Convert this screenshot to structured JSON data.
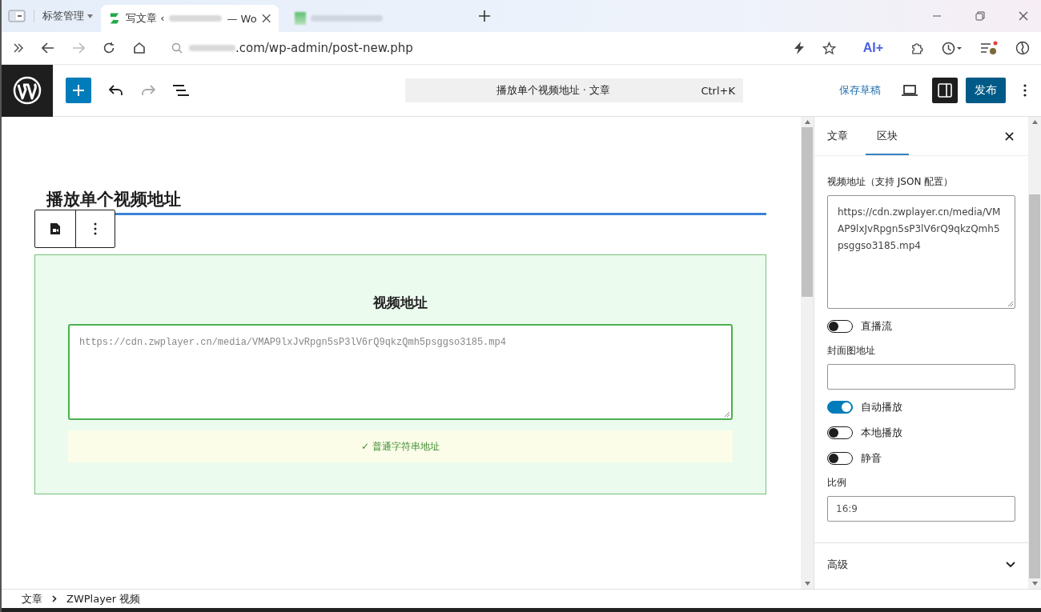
{
  "browser": {
    "tab_group": "标签管理",
    "tabs": [
      {
        "title_start": "写文章 ‹",
        "title_end": "— Wo",
        "selected": true
      },
      {
        "selected": false
      }
    ],
    "url": ".com/wp-admin/post-new.php",
    "ai_label": "AI+"
  },
  "editor_header": {
    "command_bar": {
      "title": "播放单个视频地址 · 文章",
      "shortcut": "Ctrl+K"
    },
    "save_draft": "保存草稿",
    "publish": "发布"
  },
  "post_title": "播放单个视频地址",
  "video_block": {
    "title": "视频地址",
    "url": "https://cdn.zwplayer.cn/media/VMAP9lxJvRpgn5sP3lV6rQ9qkzQmh5psggso3185.mp4",
    "status": "✓ 普通字符串地址"
  },
  "sidebar": {
    "tabs": [
      {
        "label": "文章",
        "selected": false
      },
      {
        "label": "区块",
        "selected": true
      }
    ],
    "fields": [
      {
        "kind": "textarea",
        "label": "视频地址（支持 JSON 配置）",
        "value": "https://cdn.zwplayer.cn/media/VMAP9lxJvRpgn5sP3lV6rQ9qkzQmh5psggso3185.mp4"
      },
      {
        "kind": "toggle",
        "label": "直播流",
        "on": false
      },
      {
        "kind": "text",
        "label": "封面图地址"
      },
      {
        "kind": "toggle",
        "label": "自动播放",
        "on": true
      },
      {
        "kind": "toggle",
        "label": "本地播放",
        "on": false
      },
      {
        "kind": "toggle",
        "label": "静音",
        "on": false
      },
      {
        "kind": "select",
        "label": "比例",
        "value": "16:9"
      },
      {
        "kind": "panel",
        "label": "高级",
        "expanded": false
      }
    ]
  },
  "breadcrumb": [
    "文章",
    "ZWPlayer 视频"
  ]
}
